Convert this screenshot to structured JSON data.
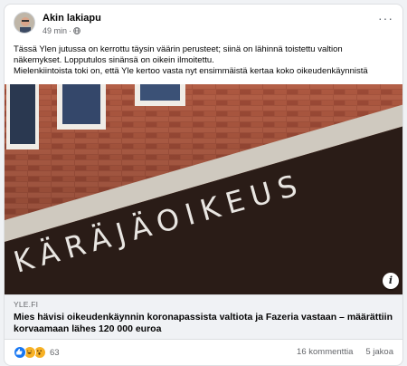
{
  "post": {
    "author": "Akin lakiapu",
    "time": "49 min",
    "text_lines": [
      "Tässä Ylen jutussa on kerrottu täysin väärin perusteet; siinä on lähinnä toistettu valtion",
      "näkemykset. Lopputulos sinänsä on oikein ilmoitettu.",
      "Mielenkiintoista toki on, että Yle kertoo vasta nyt ensimmäistä kertaa koko oikeudenkäynnistä"
    ]
  },
  "link": {
    "image_text": "KÄRÄJÄOIKEUS",
    "domain": "YLE.FI",
    "title": "Mies hävisi oikeudenkäynnin koronapassista valtiota ja Fazeria vastaan – määrättiin korvaamaan lähes 120 000 euroa"
  },
  "footer": {
    "reaction_count": "63",
    "comments": "16 kommenttia",
    "shares": "5 jakoa"
  },
  "icons": [
    "globe-icon",
    "more-icon",
    "info-icon",
    "like-icon",
    "haha-icon",
    "wow-icon"
  ],
  "colors": {
    "like": "#1877f2",
    "emoji": "#f7b125",
    "brick": "#a3523e"
  }
}
